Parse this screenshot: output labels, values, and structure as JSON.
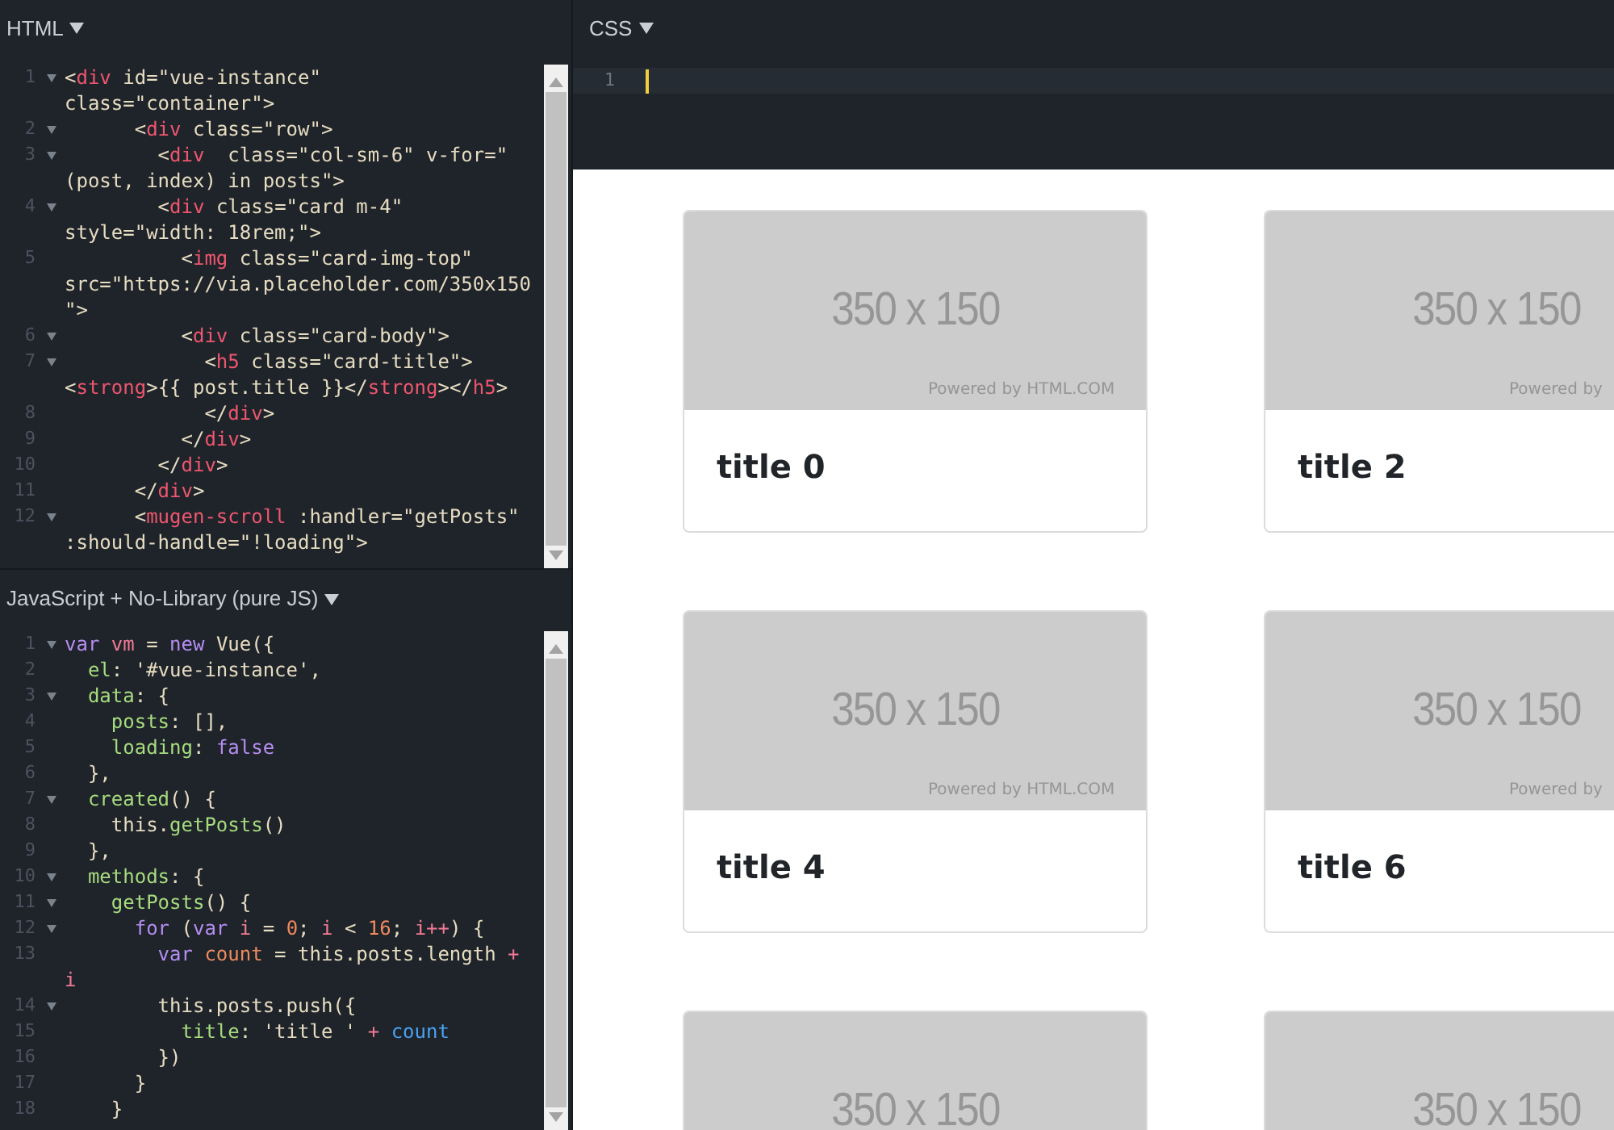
{
  "html_panel": {
    "title": "HTML",
    "lines": [
      {
        "number": "1",
        "foldable": true,
        "rows": [
          {
            "tokens": [
              {
                "text": "<",
                "kind": "punct"
              },
              {
                "text": "div",
                "kind": "tag"
              },
              {
                "text": " id=\"vue-instance\"",
                "kind": "punct"
              }
            ]
          },
          {
            "tokens": [
              {
                "text": "class=\"container\">",
                "kind": "punct"
              }
            ]
          }
        ]
      },
      {
        "number": "2",
        "foldable": true,
        "rows": [
          {
            "tokens": [
              {
                "text": "      <",
                "kind": "punct"
              },
              {
                "text": "div",
                "kind": "tag"
              },
              {
                "text": " class=\"row\">",
                "kind": "punct"
              }
            ]
          }
        ]
      },
      {
        "number": "3",
        "foldable": true,
        "rows": [
          {
            "tokens": [
              {
                "text": "        <",
                "kind": "punct"
              },
              {
                "text": "div",
                "kind": "tag"
              },
              {
                "text": "  class=\"col-sm-6\" v-for=\"",
                "kind": "punct"
              }
            ]
          },
          {
            "tokens": [
              {
                "text": "(post, index) in posts\">",
                "kind": "punct"
              }
            ]
          }
        ]
      },
      {
        "number": "4",
        "foldable": true,
        "rows": [
          {
            "tokens": [
              {
                "text": "        <",
                "kind": "punct"
              },
              {
                "text": "div",
                "kind": "tag"
              },
              {
                "text": " class=\"card m-4\"",
                "kind": "punct"
              }
            ]
          },
          {
            "tokens": [
              {
                "text": "style=\"width: 18rem;\">",
                "kind": "punct"
              }
            ]
          }
        ]
      },
      {
        "number": "5",
        "foldable": false,
        "rows": [
          {
            "tokens": [
              {
                "text": "          <",
                "kind": "punct"
              },
              {
                "text": "img",
                "kind": "tag"
              },
              {
                "text": " class=\"card-img-top\"",
                "kind": "punct"
              }
            ]
          },
          {
            "tokens": [
              {
                "text": "src=\"https://via.placeholder.com/350x150",
                "kind": "punct"
              }
            ]
          },
          {
            "tokens": [
              {
                "text": "\">",
                "kind": "punct"
              }
            ]
          }
        ]
      },
      {
        "number": "6",
        "foldable": true,
        "rows": [
          {
            "tokens": [
              {
                "text": "          <",
                "kind": "punct"
              },
              {
                "text": "div",
                "kind": "tag"
              },
              {
                "text": " class=\"card-body\">",
                "kind": "punct"
              }
            ]
          }
        ]
      },
      {
        "number": "7",
        "foldable": true,
        "rows": [
          {
            "tokens": [
              {
                "text": "            <",
                "kind": "punct"
              },
              {
                "text": "h5",
                "kind": "tag"
              },
              {
                "text": " class=\"card-title\">",
                "kind": "punct"
              }
            ]
          },
          {
            "tokens": [
              {
                "text": "<",
                "kind": "punct"
              },
              {
                "text": "strong",
                "kind": "tag"
              },
              {
                "text": ">{{ post.title }}</",
                "kind": "punct"
              },
              {
                "text": "strong",
                "kind": "tag"
              },
              {
                "text": "></",
                "kind": "punct"
              },
              {
                "text": "h5",
                "kind": "tag"
              },
              {
                "text": ">",
                "kind": "punct"
              }
            ]
          }
        ]
      },
      {
        "number": "8",
        "foldable": false,
        "rows": [
          {
            "tokens": [
              {
                "text": "            </",
                "kind": "punct"
              },
              {
                "text": "div",
                "kind": "tag"
              },
              {
                "text": ">",
                "kind": "punct"
              }
            ]
          }
        ]
      },
      {
        "number": "9",
        "foldable": false,
        "rows": [
          {
            "tokens": [
              {
                "text": "          </",
                "kind": "punct"
              },
              {
                "text": "div",
                "kind": "tag"
              },
              {
                "text": ">",
                "kind": "punct"
              }
            ]
          }
        ]
      },
      {
        "number": "10",
        "foldable": false,
        "rows": [
          {
            "tokens": [
              {
                "text": "        </",
                "kind": "punct"
              },
              {
                "text": "div",
                "kind": "tag"
              },
              {
                "text": ">",
                "kind": "punct"
              }
            ]
          }
        ]
      },
      {
        "number": "11",
        "foldable": false,
        "rows": [
          {
            "tokens": [
              {
                "text": "      </",
                "kind": "punct"
              },
              {
                "text": "div",
                "kind": "tag"
              },
              {
                "text": ">",
                "kind": "punct"
              }
            ]
          }
        ]
      },
      {
        "number": "12",
        "foldable": true,
        "rows": [
          {
            "tokens": [
              {
                "text": "      <",
                "kind": "punct"
              },
              {
                "text": "mugen-scroll",
                "kind": "tag"
              },
              {
                "text": " :handler=\"getPosts\"",
                "kind": "punct"
              }
            ]
          },
          {
            "tokens": [
              {
                "text": ":should-handle=\"!loading\">",
                "kind": "punct"
              }
            ]
          }
        ]
      }
    ]
  },
  "js_panel": {
    "title": "JavaScript + No-Library (pure JS)",
    "lines": [
      {
        "number": "1",
        "foldable": true,
        "rows": [
          {
            "tokens": [
              {
                "text": "var ",
                "kind": "keyword"
              },
              {
                "text": "vm",
                "kind": "variable"
              },
              {
                "text": " = ",
                "kind": "punct"
              },
              {
                "text": "new",
                "kind": "keyword"
              },
              {
                "text": " Vue({",
                "kind": "punct"
              }
            ]
          }
        ]
      },
      {
        "number": "2",
        "foldable": false,
        "rows": [
          {
            "tokens": [
              {
                "text": "  el",
                "kind": "property"
              },
              {
                "text": ": '#vue-instance',",
                "kind": "punct"
              }
            ]
          }
        ]
      },
      {
        "number": "3",
        "foldable": true,
        "rows": [
          {
            "tokens": [
              {
                "text": "  data",
                "kind": "property"
              },
              {
                "text": ": {",
                "kind": "punct"
              }
            ]
          }
        ]
      },
      {
        "number": "4",
        "foldable": false,
        "rows": [
          {
            "tokens": [
              {
                "text": "    posts",
                "kind": "property"
              },
              {
                "text": ": [],",
                "kind": "punct"
              }
            ]
          }
        ]
      },
      {
        "number": "5",
        "foldable": false,
        "rows": [
          {
            "tokens": [
              {
                "text": "    loading",
                "kind": "property"
              },
              {
                "text": ": ",
                "kind": "punct"
              },
              {
                "text": "false",
                "kind": "keyword"
              }
            ]
          }
        ]
      },
      {
        "number": "6",
        "foldable": false,
        "rows": [
          {
            "tokens": [
              {
                "text": "  },",
                "kind": "punct"
              }
            ]
          }
        ]
      },
      {
        "number": "7",
        "foldable": true,
        "rows": [
          {
            "tokens": [
              {
                "text": "  created",
                "kind": "property"
              },
              {
                "text": "() {",
                "kind": "punct"
              }
            ]
          }
        ]
      },
      {
        "number": "8",
        "foldable": false,
        "rows": [
          {
            "tokens": [
              {
                "text": "    this.",
                "kind": "punct"
              },
              {
                "text": "getPosts",
                "kind": "property"
              },
              {
                "text": "()",
                "kind": "punct"
              }
            ]
          }
        ]
      },
      {
        "number": "9",
        "foldable": false,
        "rows": [
          {
            "tokens": [
              {
                "text": "  },",
                "kind": "punct"
              }
            ]
          }
        ]
      },
      {
        "number": "10",
        "foldable": true,
        "rows": [
          {
            "tokens": [
              {
                "text": "  methods",
                "kind": "property"
              },
              {
                "text": ": {",
                "kind": "punct"
              }
            ]
          }
        ]
      },
      {
        "number": "11",
        "foldable": true,
        "rows": [
          {
            "tokens": [
              {
                "text": "    getPosts",
                "kind": "property"
              },
              {
                "text": "() {",
                "kind": "punct"
              }
            ]
          }
        ]
      },
      {
        "number": "12",
        "foldable": true,
        "rows": [
          {
            "tokens": [
              {
                "text": "      for",
                "kind": "keyword"
              },
              {
                "text": " (",
                "kind": "punct"
              },
              {
                "text": "var ",
                "kind": "keyword"
              },
              {
                "text": "i",
                "kind": "variable"
              },
              {
                "text": " = ",
                "kind": "punct"
              },
              {
                "text": "0",
                "kind": "number"
              },
              {
                "text": "; ",
                "kind": "punct"
              },
              {
                "text": "i",
                "kind": "variable"
              },
              {
                "text": " < ",
                "kind": "punct"
              },
              {
                "text": "16",
                "kind": "number"
              },
              {
                "text": "; ",
                "kind": "punct"
              },
              {
                "text": "i++",
                "kind": "variable"
              },
              {
                "text": ") {",
                "kind": "punct"
              }
            ]
          }
        ]
      },
      {
        "number": "13",
        "foldable": false,
        "rows": [
          {
            "tokens": [
              {
                "text": "        var ",
                "kind": "keyword"
              },
              {
                "text": "count",
                "kind": "number"
              },
              {
                "text": " = this.posts.length ",
                "kind": "punct"
              },
              {
                "text": "+",
                "kind": "variable"
              }
            ]
          },
          {
            "tokens": [
              {
                "text": "i",
                "kind": "variable"
              }
            ]
          }
        ]
      },
      {
        "number": "14",
        "foldable": true,
        "rows": [
          {
            "tokens": [
              {
                "text": "        this.posts.push({",
                "kind": "punct"
              }
            ]
          }
        ]
      },
      {
        "number": "15",
        "foldable": false,
        "rows": [
          {
            "tokens": [
              {
                "text": "          title",
                "kind": "property"
              },
              {
                "text": ": 'title ' ",
                "kind": "punct"
              },
              {
                "text": "+ ",
                "kind": "variable"
              },
              {
                "text": "count",
                "kind": "reference"
              }
            ]
          }
        ]
      },
      {
        "number": "16",
        "foldable": false,
        "rows": [
          {
            "tokens": [
              {
                "text": "        })",
                "kind": "punct"
              }
            ]
          }
        ]
      },
      {
        "number": "17",
        "foldable": false,
        "rows": [
          {
            "tokens": [
              {
                "text": "      }",
                "kind": "punct"
              }
            ]
          }
        ]
      },
      {
        "number": "18",
        "foldable": false,
        "rows": [
          {
            "tokens": [
              {
                "text": "    }",
                "kind": "punct"
              }
            ]
          }
        ]
      }
    ]
  },
  "css_panel": {
    "title": "CSS",
    "lines": [
      {
        "number": "1"
      }
    ]
  },
  "result": {
    "cards": [
      {
        "image_text": "350 x 150",
        "credit": "Powered by HTML.COM",
        "title": "title 0"
      },
      {
        "image_text": "350 x 150",
        "credit": "Powered by",
        "title": "title 2"
      },
      {
        "image_text": "350 x 150",
        "credit": "Powered by HTML.COM",
        "title": "title 4"
      },
      {
        "image_text": "350 x 150",
        "credit": "Powered by",
        "title": "title 6"
      },
      {
        "image_text": "350 x 150"
      },
      {
        "image_text": "350 x 150"
      }
    ]
  }
}
